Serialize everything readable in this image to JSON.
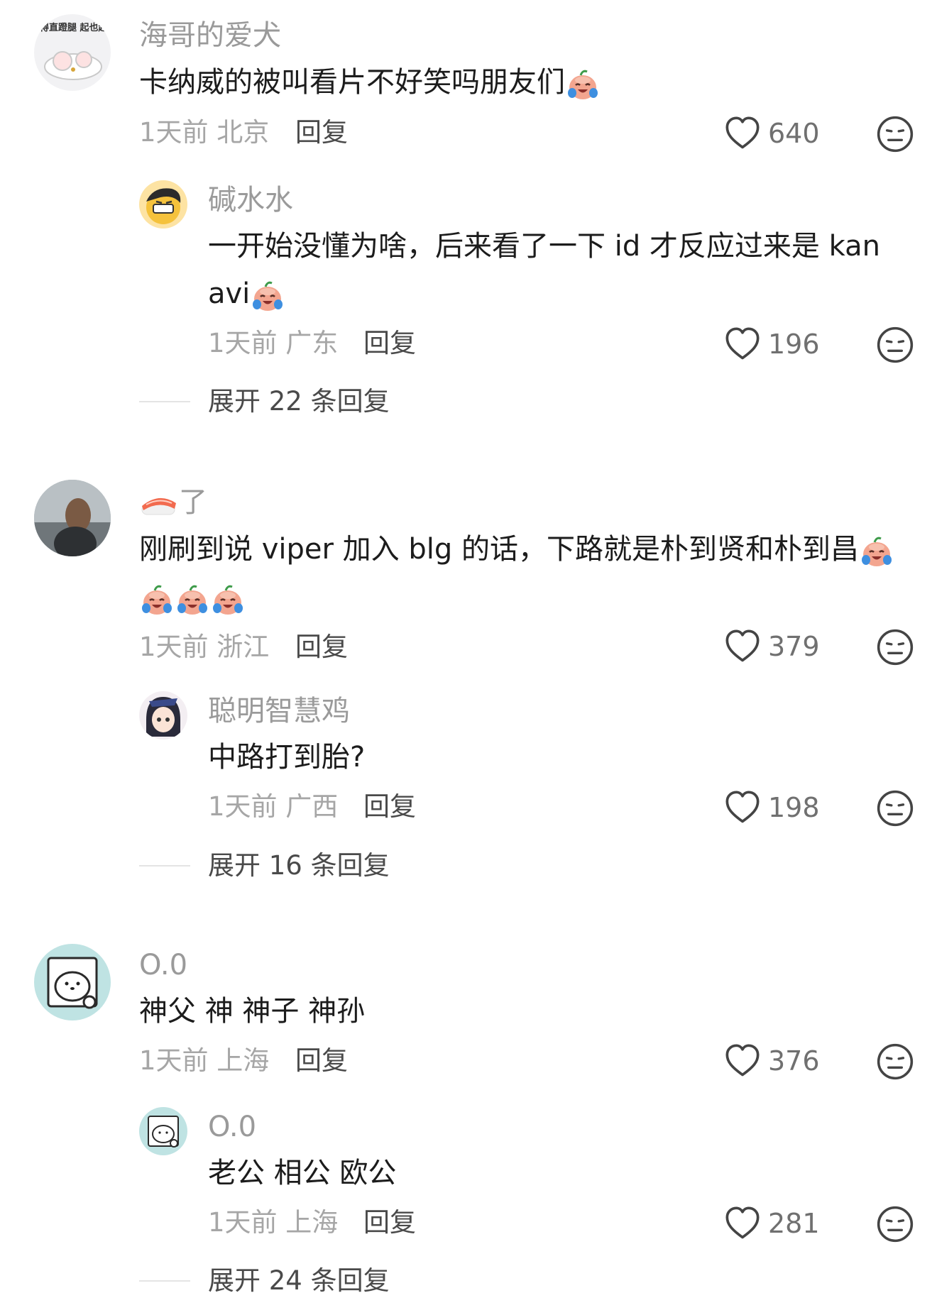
{
  "comments": [
    {
      "username": "海哥的爱犬",
      "avatar_text": "得直蹬腿 起也起",
      "text": "卡纳威的被叫看片不好笑吗朋友们",
      "time_location": "1天前 北京",
      "reply_label": "回复",
      "likes": "640",
      "sub": {
        "username": "碱水水",
        "text_line1": "一开始没懂为啥，后来看了一下 id 才反应过来是 kan",
        "text_line2": "avi",
        "time_location": "1天前 广东",
        "reply_label": "回复",
        "likes": "196"
      },
      "expand_label": "展开 22 条回复"
    },
    {
      "username": "了",
      "text_line1": "刚刷到说 viper 加入 blg 的话，下路就是朴到贤和朴到昌",
      "time_location": "1天前 浙江",
      "reply_label": "回复",
      "likes": "379",
      "sub": {
        "username": "聪明智慧鸡",
        "text": "中路打到胎?",
        "time_location": "1天前 广西",
        "reply_label": "回复",
        "likes": "198"
      },
      "expand_label": "展开 16 条回复"
    },
    {
      "username": "O.0",
      "text": "神父 神 神子 神孙",
      "time_location": "1天前 上海",
      "reply_label": "回复",
      "likes": "376",
      "sub": {
        "username": "O.0",
        "text": "老公 相公 欧公",
        "time_location": "1天前 上海",
        "reply_label": "回复",
        "likes": "281"
      },
      "expand_label": "展开 24 条回复"
    }
  ],
  "icons": {
    "like": "heart-outline-icon",
    "dislike": "neutral-face-icon",
    "emoji": "crying-laughing-peach-emoji"
  }
}
